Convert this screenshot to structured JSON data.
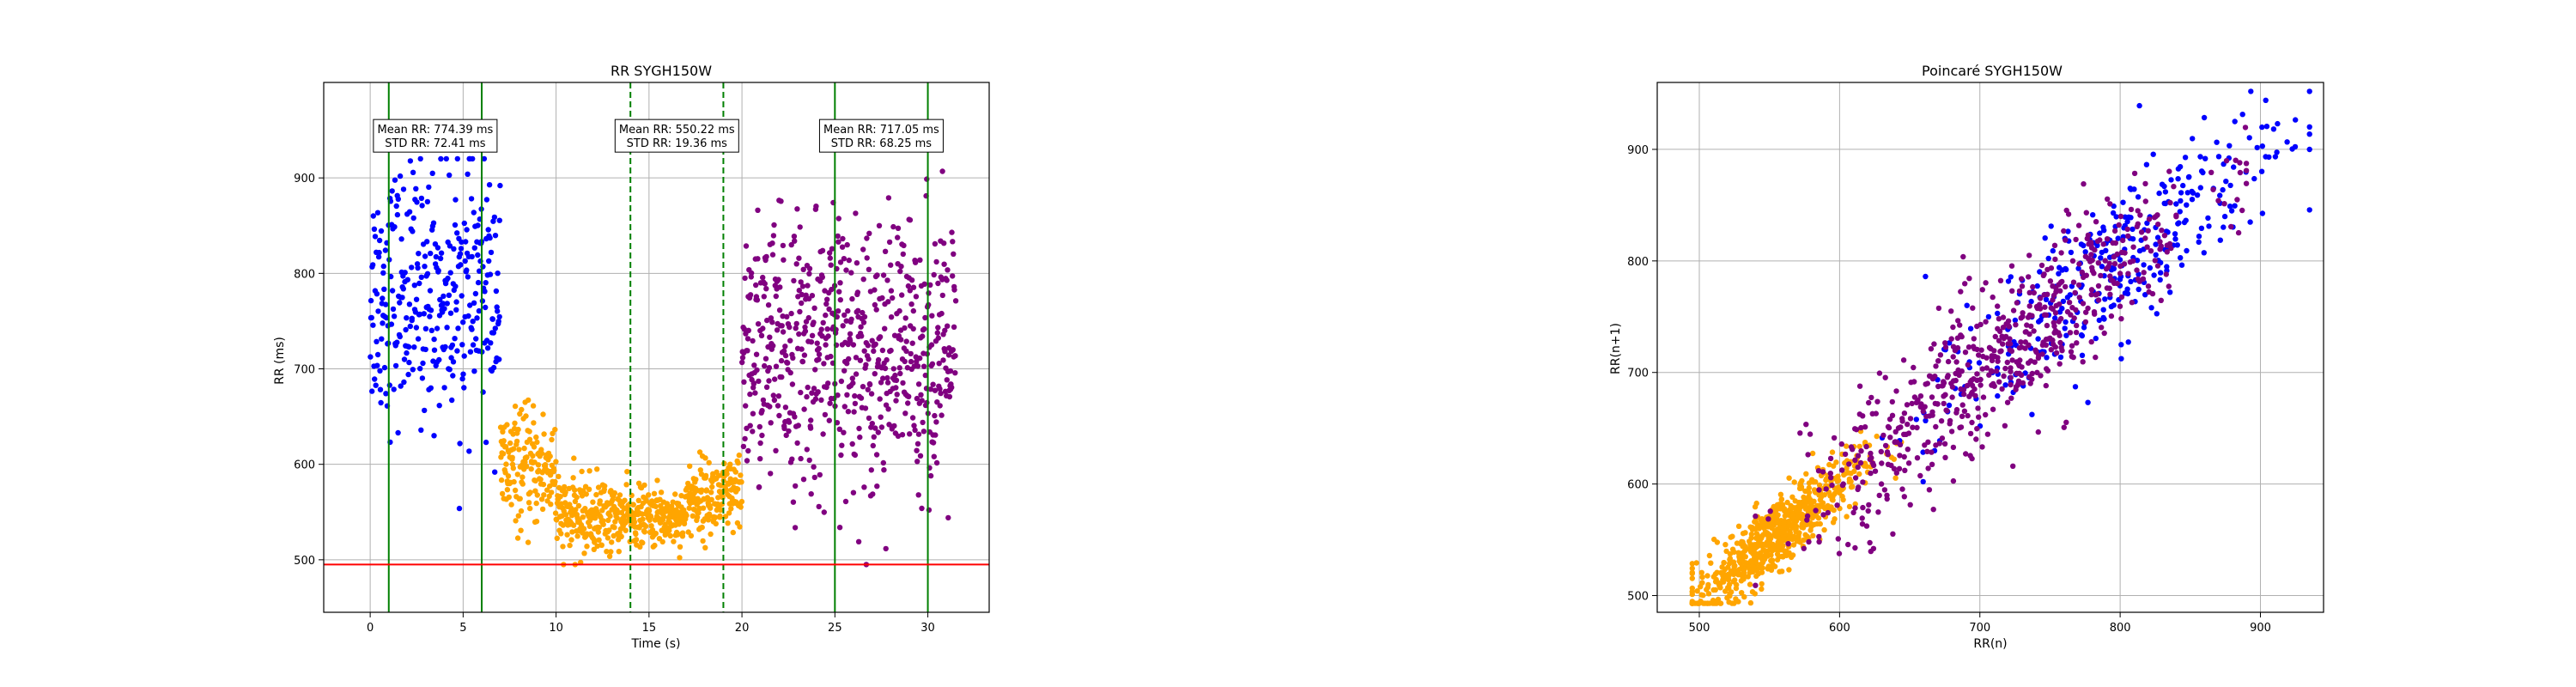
{
  "chart_data": [
    {
      "type": "scatter",
      "title": "RR SYGH150W",
      "xlabel": "Time (s)",
      "ylabel": "RR (ms)",
      "xlim": [
        -2.5,
        33.3
      ],
      "ylim": [
        445,
        1000
      ],
      "xticks": [
        0,
        5,
        10,
        15,
        20,
        25,
        30
      ],
      "yticks": [
        500,
        600,
        700,
        800,
        900
      ],
      "grid": true,
      "series": [
        {
          "color": "#0000ff",
          "segments": [
            {
              "x_start": 0,
              "x_end": 7,
              "mean": 780,
              "sd": 65,
              "points": 340
            }
          ]
        },
        {
          "color": "#ffa500",
          "segments": [
            {
              "x_start": 7,
              "x_end": 10,
              "mean": 595,
              "sd": 30,
              "points": 160
            },
            {
              "x_start": 10,
              "x_end": 13,
              "mean": 545,
              "sd": 20,
              "points": 170
            },
            {
              "x_start": 13,
              "x_end": 17,
              "mean": 545,
              "sd": 15,
              "points": 230
            },
            {
              "x_start": 17,
              "x_end": 20,
              "mean": 565,
              "sd": 20,
              "points": 170
            }
          ]
        },
        {
          "color": "#800080",
          "segments": [
            {
              "x_start": 20,
              "x_end": 31.5,
              "mean": 717,
              "sd": 70,
              "points": 650
            }
          ]
        }
      ],
      "vertical_lines": [
        {
          "x": 1,
          "style": "solid",
          "color": "#008000"
        },
        {
          "x": 6,
          "style": "solid",
          "color": "#008000"
        },
        {
          "x": 14,
          "style": "dashed",
          "color": "#008000"
        },
        {
          "x": 19,
          "style": "dashed",
          "color": "#008000"
        },
        {
          "x": 25,
          "style": "solid",
          "color": "#008000"
        },
        {
          "x": 30,
          "style": "solid",
          "color": "#008000"
        }
      ],
      "horizontal_lines": [
        {
          "y": 495,
          "color": "#ff0000"
        }
      ],
      "annotations": [
        {
          "x": 3.5,
          "y": 945,
          "lines": [
            "Mean RR: 774.39 ms",
            "STD RR: 72.41 ms"
          ]
        },
        {
          "x": 16.5,
          "y": 945,
          "lines": [
            "Mean RR: 550.22 ms",
            "STD RR: 19.36 ms"
          ]
        },
        {
          "x": 27.5,
          "y": 945,
          "lines": [
            "Mean RR: 717.05 ms",
            "STD RR: 68.25 ms"
          ]
        }
      ]
    },
    {
      "type": "scatter",
      "title": "Poincaré SYGH150W",
      "xlabel": "RR(n)",
      "ylabel": "RR(n+1)",
      "xlim": [
        470,
        945
      ],
      "ylim": [
        485,
        960
      ],
      "xticks": [
        500,
        600,
        700,
        800,
        900
      ],
      "yticks": [
        500,
        600,
        700,
        800,
        900
      ],
      "grid": true,
      "series": [
        {
          "color": "#ffa500",
          "x_range": [
            495,
            700
          ],
          "center": 555,
          "sd": 30,
          "spread": 16,
          "points": 700
        },
        {
          "color": "#0000ff",
          "x_range": [
            600,
            935
          ],
          "center": 790,
          "sd": 65,
          "spread": 35,
          "points": 330
        },
        {
          "color": "#800080",
          "x_range": [
            540,
            890
          ],
          "center": 717,
          "sd": 70,
          "spread": 35,
          "points": 640
        }
      ]
    }
  ]
}
